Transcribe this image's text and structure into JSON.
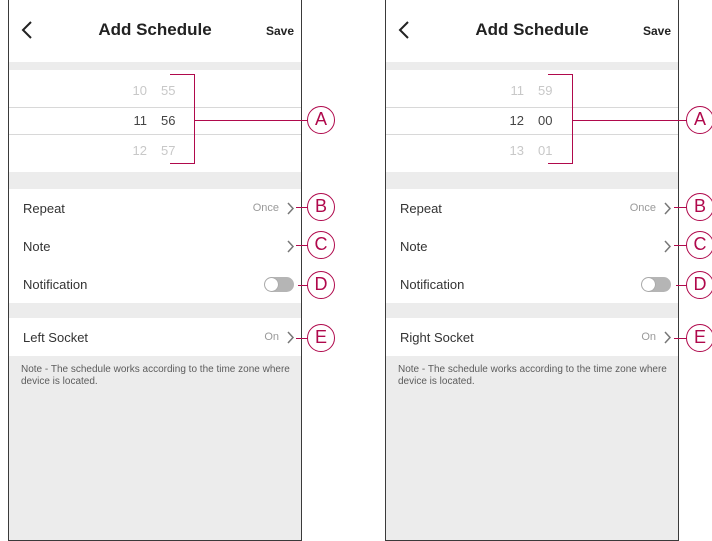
{
  "accent_color": "#b0094c",
  "screens": [
    {
      "header": {
        "back_icon": "chevron-left-icon",
        "title": "Add Schedule",
        "save_label": "Save"
      },
      "time_picker": {
        "rows": [
          {
            "hour": "10",
            "minute": "55"
          },
          {
            "hour": "11",
            "minute": "56"
          },
          {
            "hour": "12",
            "minute": "57"
          }
        ]
      },
      "settings": {
        "repeat": {
          "label": "Repeat",
          "value": "Once"
        },
        "note": {
          "label": "Note"
        },
        "notification": {
          "label": "Notification",
          "enabled": false
        },
        "socket": {
          "label": "Left Socket",
          "value": "On"
        }
      },
      "footer_note": "Note - The schedule works according to the time zone where device is located."
    },
    {
      "header": {
        "back_icon": "chevron-left-icon",
        "title": "Add Schedule",
        "save_label": "Save"
      },
      "time_picker": {
        "rows": [
          {
            "hour": "11",
            "minute": "59"
          },
          {
            "hour": "12",
            "minute": "00"
          },
          {
            "hour": "13",
            "minute": "01"
          }
        ]
      },
      "settings": {
        "repeat": {
          "label": "Repeat",
          "value": "Once"
        },
        "note": {
          "label": "Note"
        },
        "notification": {
          "label": "Notification",
          "enabled": false
        },
        "socket": {
          "label": "Right Socket",
          "value": "On"
        }
      },
      "footer_note": "Note - The schedule works according to the time zone where device is located."
    }
  ],
  "callouts": [
    "A",
    "B",
    "C",
    "D",
    "E"
  ]
}
